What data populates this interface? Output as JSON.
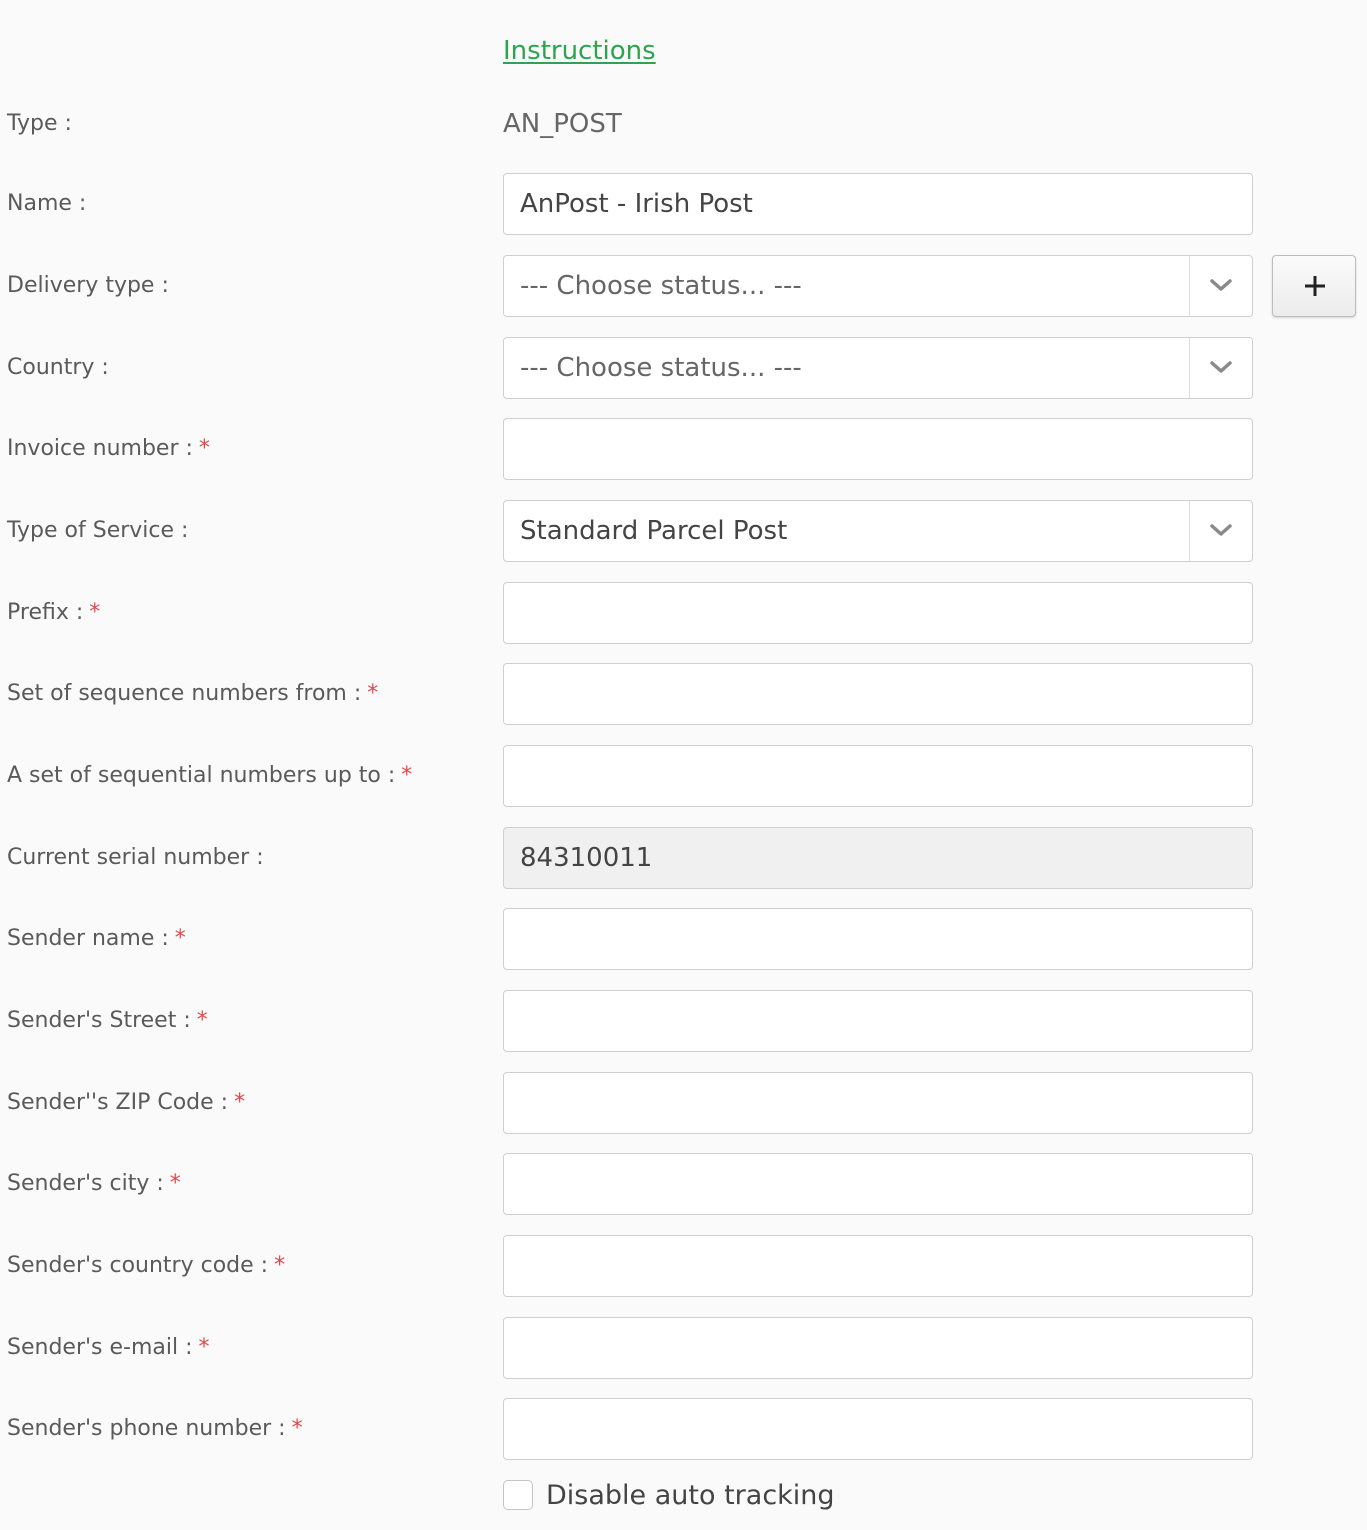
{
  "instructions_link": "Instructions",
  "type": {
    "label": "Type :",
    "value": "AN_POST"
  },
  "name": {
    "label": "Name :",
    "value": "AnPost - Irish Post"
  },
  "delivery_type": {
    "label": "Delivery type :",
    "selected": "--- Choose status... ---",
    "add_button": "+"
  },
  "country": {
    "label": "Country :",
    "selected": "--- Choose status... ---"
  },
  "invoice_number": {
    "label": "Invoice number :",
    "required": "*",
    "value": ""
  },
  "type_of_service": {
    "label": "Type of Service :",
    "selected": "Standard Parcel Post"
  },
  "prefix": {
    "label": "Prefix :",
    "required": "*",
    "value": ""
  },
  "sequence_from": {
    "label": "Set of sequence numbers from :",
    "required": "*",
    "value": ""
  },
  "sequence_to": {
    "label": "A set of sequential numbers up to :",
    "required": "*",
    "value": ""
  },
  "current_serial": {
    "label": "Current serial number :",
    "value": "84310011"
  },
  "sender_name": {
    "label": "Sender name :",
    "required": "*",
    "value": ""
  },
  "sender_street": {
    "label": "Sender's Street :",
    "required": "*",
    "value": ""
  },
  "sender_zip": {
    "label": "Sender''s ZIP Code :",
    "required": "*",
    "value": ""
  },
  "sender_city": {
    "label": "Sender's city :",
    "required": "*",
    "value": ""
  },
  "sender_country_code": {
    "label": "Sender's country code :",
    "required": "*",
    "value": ""
  },
  "sender_email": {
    "label": "Sender's e-mail :",
    "required": "*",
    "value": ""
  },
  "sender_phone": {
    "label": "Sender's phone number :",
    "required": "*",
    "value": ""
  },
  "disable_auto_tracking": {
    "label": "Disable auto tracking",
    "checked": false
  },
  "colors": {
    "link": "#2ea44f",
    "required": "#e0484d",
    "page_bg": "#fafafa"
  }
}
